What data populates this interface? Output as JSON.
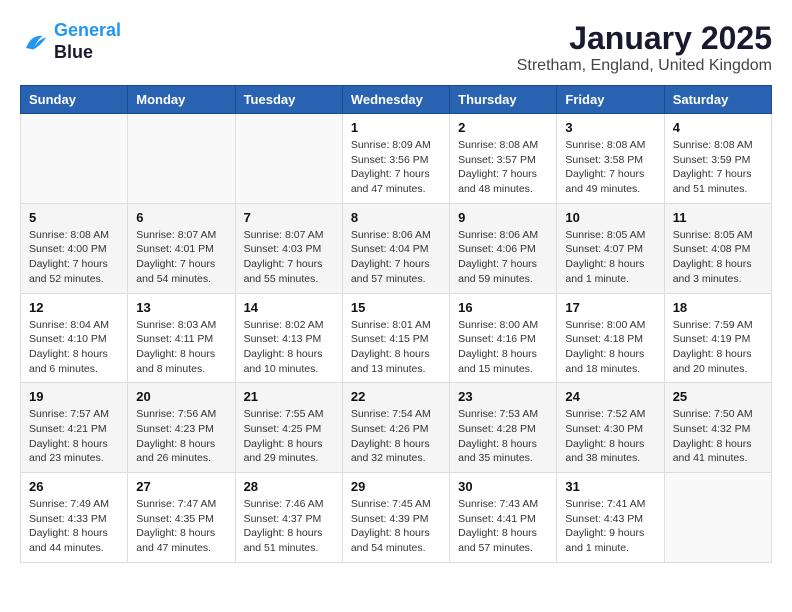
{
  "logo": {
    "line1": "General",
    "line2": "Blue"
  },
  "title": "January 2025",
  "location": "Stretham, England, United Kingdom",
  "weekdays": [
    "Sunday",
    "Monday",
    "Tuesday",
    "Wednesday",
    "Thursday",
    "Friday",
    "Saturday"
  ],
  "weeks": [
    [
      {
        "day": "",
        "info": ""
      },
      {
        "day": "",
        "info": ""
      },
      {
        "day": "",
        "info": ""
      },
      {
        "day": "1",
        "info": "Sunrise: 8:09 AM\nSunset: 3:56 PM\nDaylight: 7 hours and 47 minutes."
      },
      {
        "day": "2",
        "info": "Sunrise: 8:08 AM\nSunset: 3:57 PM\nDaylight: 7 hours and 48 minutes."
      },
      {
        "day": "3",
        "info": "Sunrise: 8:08 AM\nSunset: 3:58 PM\nDaylight: 7 hours and 49 minutes."
      },
      {
        "day": "4",
        "info": "Sunrise: 8:08 AM\nSunset: 3:59 PM\nDaylight: 7 hours and 51 minutes."
      }
    ],
    [
      {
        "day": "5",
        "info": "Sunrise: 8:08 AM\nSunset: 4:00 PM\nDaylight: 7 hours and 52 minutes."
      },
      {
        "day": "6",
        "info": "Sunrise: 8:07 AM\nSunset: 4:01 PM\nDaylight: 7 hours and 54 minutes."
      },
      {
        "day": "7",
        "info": "Sunrise: 8:07 AM\nSunset: 4:03 PM\nDaylight: 7 hours and 55 minutes."
      },
      {
        "day": "8",
        "info": "Sunrise: 8:06 AM\nSunset: 4:04 PM\nDaylight: 7 hours and 57 minutes."
      },
      {
        "day": "9",
        "info": "Sunrise: 8:06 AM\nSunset: 4:06 PM\nDaylight: 7 hours and 59 minutes."
      },
      {
        "day": "10",
        "info": "Sunrise: 8:05 AM\nSunset: 4:07 PM\nDaylight: 8 hours and 1 minute."
      },
      {
        "day": "11",
        "info": "Sunrise: 8:05 AM\nSunset: 4:08 PM\nDaylight: 8 hours and 3 minutes."
      }
    ],
    [
      {
        "day": "12",
        "info": "Sunrise: 8:04 AM\nSunset: 4:10 PM\nDaylight: 8 hours and 6 minutes."
      },
      {
        "day": "13",
        "info": "Sunrise: 8:03 AM\nSunset: 4:11 PM\nDaylight: 8 hours and 8 minutes."
      },
      {
        "day": "14",
        "info": "Sunrise: 8:02 AM\nSunset: 4:13 PM\nDaylight: 8 hours and 10 minutes."
      },
      {
        "day": "15",
        "info": "Sunrise: 8:01 AM\nSunset: 4:15 PM\nDaylight: 8 hours and 13 minutes."
      },
      {
        "day": "16",
        "info": "Sunrise: 8:00 AM\nSunset: 4:16 PM\nDaylight: 8 hours and 15 minutes."
      },
      {
        "day": "17",
        "info": "Sunrise: 8:00 AM\nSunset: 4:18 PM\nDaylight: 8 hours and 18 minutes."
      },
      {
        "day": "18",
        "info": "Sunrise: 7:59 AM\nSunset: 4:19 PM\nDaylight: 8 hours and 20 minutes."
      }
    ],
    [
      {
        "day": "19",
        "info": "Sunrise: 7:57 AM\nSunset: 4:21 PM\nDaylight: 8 hours and 23 minutes."
      },
      {
        "day": "20",
        "info": "Sunrise: 7:56 AM\nSunset: 4:23 PM\nDaylight: 8 hours and 26 minutes."
      },
      {
        "day": "21",
        "info": "Sunrise: 7:55 AM\nSunset: 4:25 PM\nDaylight: 8 hours and 29 minutes."
      },
      {
        "day": "22",
        "info": "Sunrise: 7:54 AM\nSunset: 4:26 PM\nDaylight: 8 hours and 32 minutes."
      },
      {
        "day": "23",
        "info": "Sunrise: 7:53 AM\nSunset: 4:28 PM\nDaylight: 8 hours and 35 minutes."
      },
      {
        "day": "24",
        "info": "Sunrise: 7:52 AM\nSunset: 4:30 PM\nDaylight: 8 hours and 38 minutes."
      },
      {
        "day": "25",
        "info": "Sunrise: 7:50 AM\nSunset: 4:32 PM\nDaylight: 8 hours and 41 minutes."
      }
    ],
    [
      {
        "day": "26",
        "info": "Sunrise: 7:49 AM\nSunset: 4:33 PM\nDaylight: 8 hours and 44 minutes."
      },
      {
        "day": "27",
        "info": "Sunrise: 7:47 AM\nSunset: 4:35 PM\nDaylight: 8 hours and 47 minutes."
      },
      {
        "day": "28",
        "info": "Sunrise: 7:46 AM\nSunset: 4:37 PM\nDaylight: 8 hours and 51 minutes."
      },
      {
        "day": "29",
        "info": "Sunrise: 7:45 AM\nSunset: 4:39 PM\nDaylight: 8 hours and 54 minutes."
      },
      {
        "day": "30",
        "info": "Sunrise: 7:43 AM\nSunset: 4:41 PM\nDaylight: 8 hours and 57 minutes."
      },
      {
        "day": "31",
        "info": "Sunrise: 7:41 AM\nSunset: 4:43 PM\nDaylight: 9 hours and 1 minute."
      },
      {
        "day": "",
        "info": ""
      }
    ]
  ]
}
